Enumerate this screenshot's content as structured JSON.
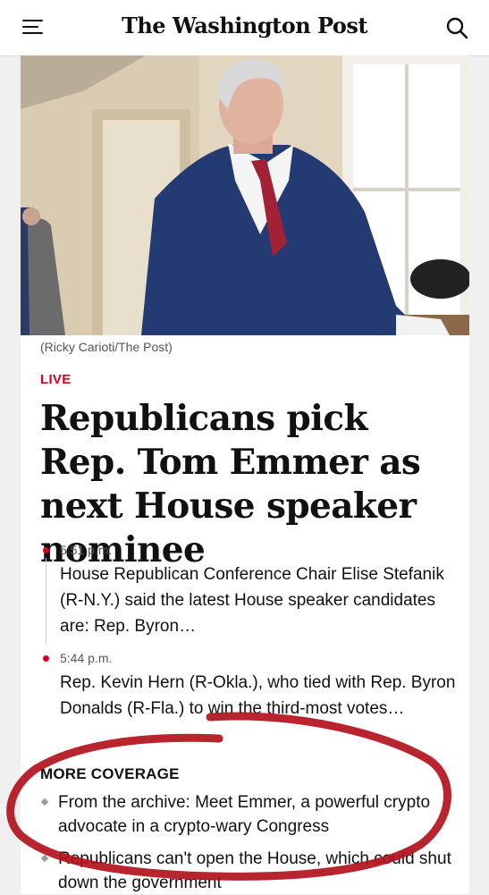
{
  "header": {
    "brand": "The Washington Post",
    "menu_icon": "hamburger-menu-icon",
    "search_icon": "search-icon"
  },
  "article": {
    "photo_caption": "(Ricky Carioti/The Post)",
    "live_label": "LIVE",
    "headline": "Republicans pick Rep. Tom Emmer as next House speaker nominee",
    "updates": [
      {
        "time": "5:51 p.m.",
        "text": "House Republican Conference Chair Elise Stefanik (R-N.Y.) said the latest House speaker candidates are: Rep. Byron…"
      },
      {
        "time": "5:44 p.m.",
        "text": "Rep. Kevin Hern (R-Okla.), who tied with Rep. Byron Donalds (R-Fla.) to win the third-most votes…"
      }
    ],
    "more_coverage": {
      "title": "MORE COVERAGE",
      "items": [
        "From the archive: Meet Emmer, a powerful crypto advocate in a crypto-wary Congress",
        "Republicans can't open the House, which could shut down the government"
      ]
    }
  },
  "colors": {
    "live_red": "#d0021b",
    "annotation_red": "#b3121c"
  }
}
